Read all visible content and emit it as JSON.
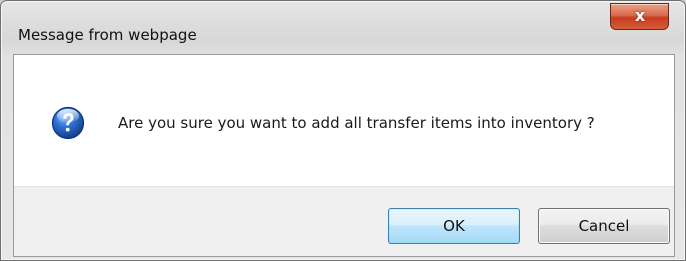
{
  "dialog": {
    "title": "Message from webpage",
    "close_glyph": "x",
    "message": "Are you sure you want to add all transfer items into inventory ?",
    "icon": "question-icon",
    "buttons": {
      "ok_label": "OK",
      "cancel_label": "Cancel"
    }
  },
  "colors": {
    "close_button": "#c73d20",
    "ok_button_border": "#3c7fb1",
    "question_icon_blue": "#1f5fb5"
  }
}
